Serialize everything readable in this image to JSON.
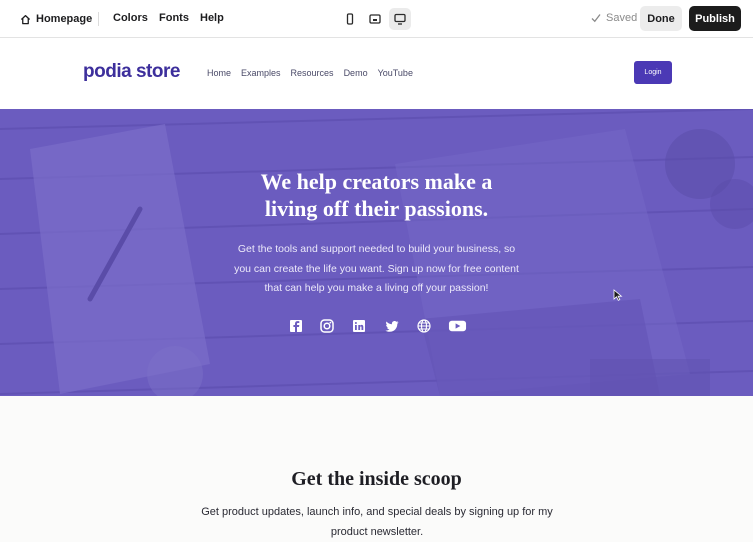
{
  "editor": {
    "home_label": "Homepage",
    "menu": [
      "Colors",
      "Fonts",
      "Help"
    ],
    "devices": [
      "phone-icon",
      "tablet-icon",
      "desktop-icon"
    ],
    "active_device": "desktop",
    "status": "Saved",
    "done_label": "Done",
    "publish_label": "Publish"
  },
  "site": {
    "logo": "podia store",
    "nav": [
      "Home",
      "Examples",
      "Resources",
      "Demo",
      "YouTube"
    ],
    "login_label": "Login",
    "accent_color": "#4b39b5"
  },
  "hero": {
    "title_line1": "We help creators make a",
    "title_line2": "living off their passions.",
    "subtitle": "Get the tools and support needed to build your business, so you can create the life you want. Sign up now for free content that can help you make a living off your passion!",
    "overlay_color": "#6a5bc0",
    "social_icons": [
      "facebook-icon",
      "instagram-icon",
      "linkedin-icon",
      "twitter-icon",
      "globe-icon",
      "youtube-icon"
    ]
  },
  "newsletter": {
    "title": "Get the inside scoop",
    "text": "Get product updates, launch info, and special deals by signing up for my product newsletter."
  }
}
